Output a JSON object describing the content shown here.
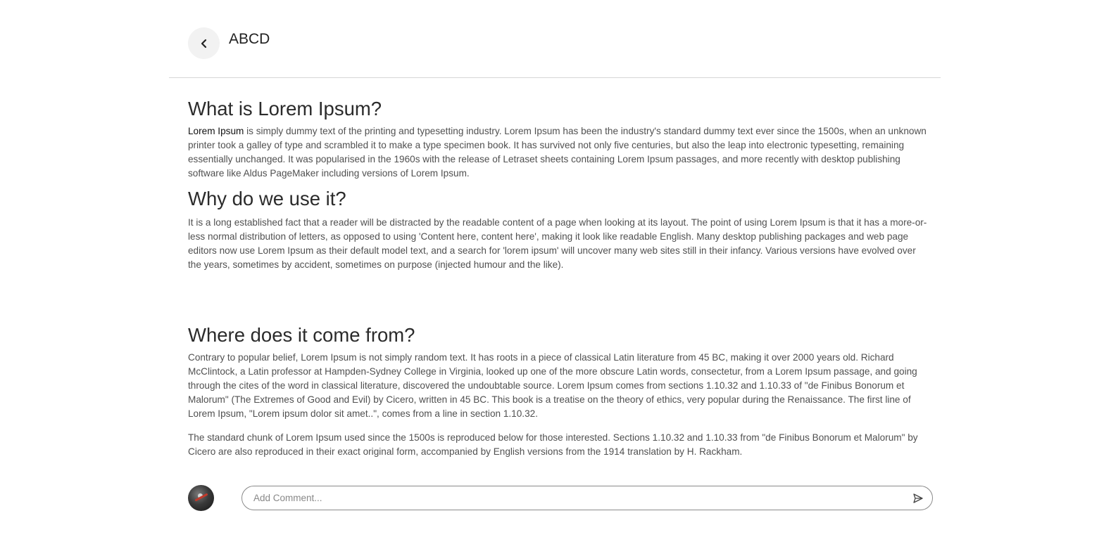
{
  "header": {
    "title": "ABCD",
    "back_icon": "chevron-left-icon"
  },
  "sections": [
    {
      "title": "What is Lorem Ipsum?",
      "lead": "Lorem Ipsum",
      "body": " is simply dummy text of the printing and typesetting industry. Lorem Ipsum has been the industry's standard dummy text ever since the 1500s, when an unknown printer took a galley of type and scrambled it to make a type specimen book. It has survived not only five centuries, but also the leap into electronic typesetting, remaining essentially unchanged. It was popularised in the 1960s with the release of Letraset sheets containing Lorem Ipsum passages, and more recently with desktop publishing software like Aldus PageMaker including versions of Lorem Ipsum."
    },
    {
      "title": "Why do we use it?",
      "body": "It is a long established fact that a reader will be distracted by the readable content of a page when looking at its layout. The point of using Lorem Ipsum is that it has a more-or-less normal distribution of letters, as opposed to using 'Content here, content here', making it look like readable English. Many desktop publishing packages and web page editors now use Lorem Ipsum as their default model text, and a search for 'lorem ipsum' will uncover many web sites still in their infancy. Various versions have evolved over the years, sometimes by accident, sometimes on purpose (injected humour and the like)."
    },
    {
      "title": "Where does it come from?",
      "body": "Contrary to popular belief, Lorem Ipsum is not simply random text. It has roots in a piece of classical Latin literature from 45 BC, making it over 2000 years old. Richard McClintock, a Latin professor at Hampden-Sydney College in Virginia, looked up one of the more obscure Latin words, consectetur, from a Lorem Ipsum passage, and going through the cites of the word in classical literature, discovered the undoubtable source. Lorem Ipsum comes from sections 1.10.32 and 1.10.33 of \"de Finibus Bonorum et Malorum\" (The Extremes of Good and Evil) by Cicero, written in 45 BC. This book is a treatise on the theory of ethics, very popular during the Renaissance. The first line of Lorem Ipsum, \"Lorem ipsum dolor sit amet..\", comes from a line in section 1.10.32.",
      "body2": "The standard chunk of Lorem Ipsum used since the 1500s is reproduced below for those interested. Sections 1.10.32 and 1.10.33 from \"de Finibus Bonorum et Malorum\" by Cicero are also reproduced in their exact original form, accompanied by English versions from the 1914 translation by H. Rackham."
    }
  ],
  "comment": {
    "placeholder": "Add Comment...",
    "value": "",
    "avatar_icon": "user-avatar",
    "send_icon": "send-icon"
  }
}
